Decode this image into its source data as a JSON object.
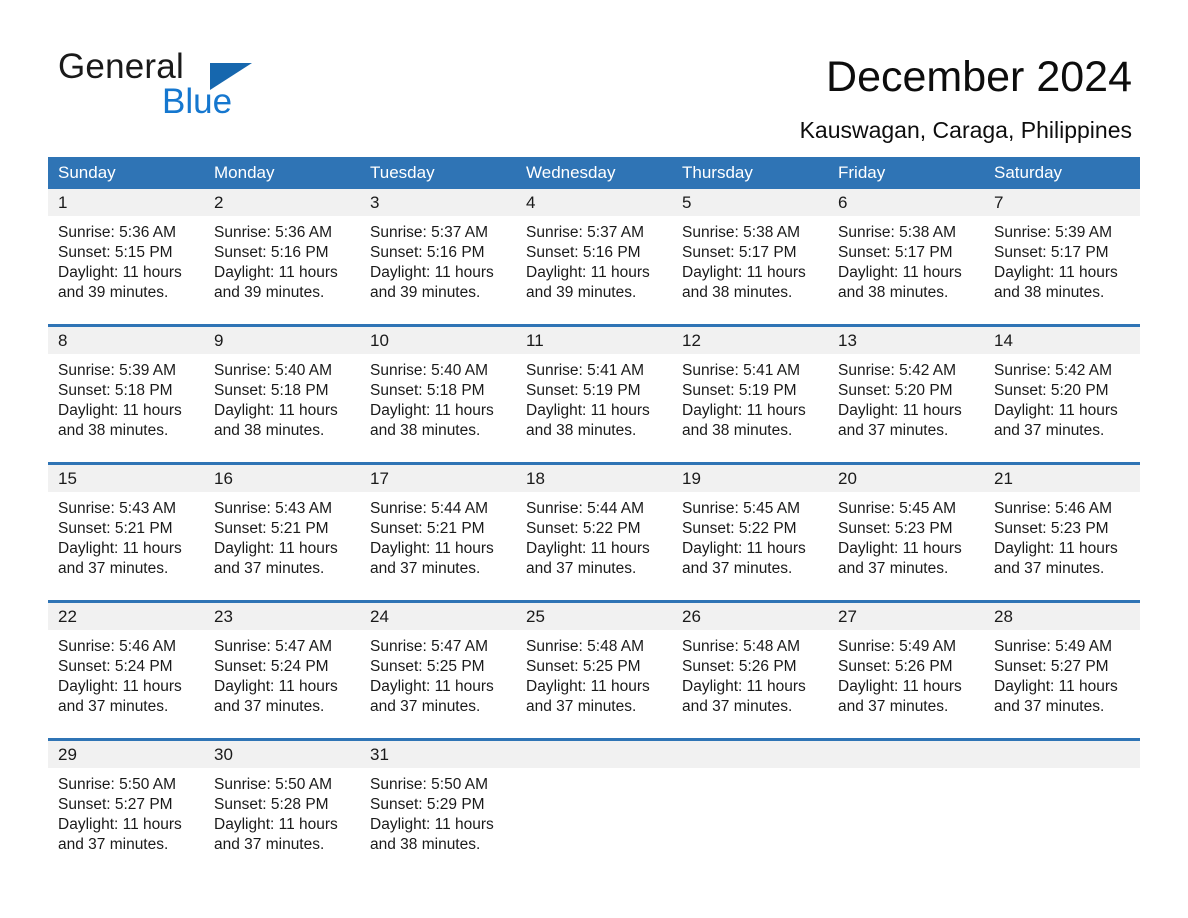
{
  "brand": {
    "name_part1": "General",
    "name_part2": "Blue",
    "triangle_icon": "triangle-icon",
    "accent_color": "#1667ae",
    "blue_text_color": "#1577cf"
  },
  "header": {
    "title": "December 2024",
    "subtitle": "Kauswagan, Caraga, Philippines"
  },
  "calendar": {
    "header_bg": "#2f74b5",
    "day_band_bg": "#f1f1f1",
    "weekdays": [
      "Sunday",
      "Monday",
      "Tuesday",
      "Wednesday",
      "Thursday",
      "Friday",
      "Saturday"
    ],
    "weeks": [
      [
        {
          "day": "1",
          "sunrise": "Sunrise: 5:36 AM",
          "sunset": "Sunset: 5:15 PM",
          "daylight_line1": "Daylight: 11 hours",
          "daylight_line2": "and 39 minutes."
        },
        {
          "day": "2",
          "sunrise": "Sunrise: 5:36 AM",
          "sunset": "Sunset: 5:16 PM",
          "daylight_line1": "Daylight: 11 hours",
          "daylight_line2": "and 39 minutes."
        },
        {
          "day": "3",
          "sunrise": "Sunrise: 5:37 AM",
          "sunset": "Sunset: 5:16 PM",
          "daylight_line1": "Daylight: 11 hours",
          "daylight_line2": "and 39 minutes."
        },
        {
          "day": "4",
          "sunrise": "Sunrise: 5:37 AM",
          "sunset": "Sunset: 5:16 PM",
          "daylight_line1": "Daylight: 11 hours",
          "daylight_line2": "and 39 minutes."
        },
        {
          "day": "5",
          "sunrise": "Sunrise: 5:38 AM",
          "sunset": "Sunset: 5:17 PM",
          "daylight_line1": "Daylight: 11 hours",
          "daylight_line2": "and 38 minutes."
        },
        {
          "day": "6",
          "sunrise": "Sunrise: 5:38 AM",
          "sunset": "Sunset: 5:17 PM",
          "daylight_line1": "Daylight: 11 hours",
          "daylight_line2": "and 38 minutes."
        },
        {
          "day": "7",
          "sunrise": "Sunrise: 5:39 AM",
          "sunset": "Sunset: 5:17 PM",
          "daylight_line1": "Daylight: 11 hours",
          "daylight_line2": "and 38 minutes."
        }
      ],
      [
        {
          "day": "8",
          "sunrise": "Sunrise: 5:39 AM",
          "sunset": "Sunset: 5:18 PM",
          "daylight_line1": "Daylight: 11 hours",
          "daylight_line2": "and 38 minutes."
        },
        {
          "day": "9",
          "sunrise": "Sunrise: 5:40 AM",
          "sunset": "Sunset: 5:18 PM",
          "daylight_line1": "Daylight: 11 hours",
          "daylight_line2": "and 38 minutes."
        },
        {
          "day": "10",
          "sunrise": "Sunrise: 5:40 AM",
          "sunset": "Sunset: 5:18 PM",
          "daylight_line1": "Daylight: 11 hours",
          "daylight_line2": "and 38 minutes."
        },
        {
          "day": "11",
          "sunrise": "Sunrise: 5:41 AM",
          "sunset": "Sunset: 5:19 PM",
          "daylight_line1": "Daylight: 11 hours",
          "daylight_line2": "and 38 minutes."
        },
        {
          "day": "12",
          "sunrise": "Sunrise: 5:41 AM",
          "sunset": "Sunset: 5:19 PM",
          "daylight_line1": "Daylight: 11 hours",
          "daylight_line2": "and 38 minutes."
        },
        {
          "day": "13",
          "sunrise": "Sunrise: 5:42 AM",
          "sunset": "Sunset: 5:20 PM",
          "daylight_line1": "Daylight: 11 hours",
          "daylight_line2": "and 37 minutes."
        },
        {
          "day": "14",
          "sunrise": "Sunrise: 5:42 AM",
          "sunset": "Sunset: 5:20 PM",
          "daylight_line1": "Daylight: 11 hours",
          "daylight_line2": "and 37 minutes."
        }
      ],
      [
        {
          "day": "15",
          "sunrise": "Sunrise: 5:43 AM",
          "sunset": "Sunset: 5:21 PM",
          "daylight_line1": "Daylight: 11 hours",
          "daylight_line2": "and 37 minutes."
        },
        {
          "day": "16",
          "sunrise": "Sunrise: 5:43 AM",
          "sunset": "Sunset: 5:21 PM",
          "daylight_line1": "Daylight: 11 hours",
          "daylight_line2": "and 37 minutes."
        },
        {
          "day": "17",
          "sunrise": "Sunrise: 5:44 AM",
          "sunset": "Sunset: 5:21 PM",
          "daylight_line1": "Daylight: 11 hours",
          "daylight_line2": "and 37 minutes."
        },
        {
          "day": "18",
          "sunrise": "Sunrise: 5:44 AM",
          "sunset": "Sunset: 5:22 PM",
          "daylight_line1": "Daylight: 11 hours",
          "daylight_line2": "and 37 minutes."
        },
        {
          "day": "19",
          "sunrise": "Sunrise: 5:45 AM",
          "sunset": "Sunset: 5:22 PM",
          "daylight_line1": "Daylight: 11 hours",
          "daylight_line2": "and 37 minutes."
        },
        {
          "day": "20",
          "sunrise": "Sunrise: 5:45 AM",
          "sunset": "Sunset: 5:23 PM",
          "daylight_line1": "Daylight: 11 hours",
          "daylight_line2": "and 37 minutes."
        },
        {
          "day": "21",
          "sunrise": "Sunrise: 5:46 AM",
          "sunset": "Sunset: 5:23 PM",
          "daylight_line1": "Daylight: 11 hours",
          "daylight_line2": "and 37 minutes."
        }
      ],
      [
        {
          "day": "22",
          "sunrise": "Sunrise: 5:46 AM",
          "sunset": "Sunset: 5:24 PM",
          "daylight_line1": "Daylight: 11 hours",
          "daylight_line2": "and 37 minutes."
        },
        {
          "day": "23",
          "sunrise": "Sunrise: 5:47 AM",
          "sunset": "Sunset: 5:24 PM",
          "daylight_line1": "Daylight: 11 hours",
          "daylight_line2": "and 37 minutes."
        },
        {
          "day": "24",
          "sunrise": "Sunrise: 5:47 AM",
          "sunset": "Sunset: 5:25 PM",
          "daylight_line1": "Daylight: 11 hours",
          "daylight_line2": "and 37 minutes."
        },
        {
          "day": "25",
          "sunrise": "Sunrise: 5:48 AM",
          "sunset": "Sunset: 5:25 PM",
          "daylight_line1": "Daylight: 11 hours",
          "daylight_line2": "and 37 minutes."
        },
        {
          "day": "26",
          "sunrise": "Sunrise: 5:48 AM",
          "sunset": "Sunset: 5:26 PM",
          "daylight_line1": "Daylight: 11 hours",
          "daylight_line2": "and 37 minutes."
        },
        {
          "day": "27",
          "sunrise": "Sunrise: 5:49 AM",
          "sunset": "Sunset: 5:26 PM",
          "daylight_line1": "Daylight: 11 hours",
          "daylight_line2": "and 37 minutes."
        },
        {
          "day": "28",
          "sunrise": "Sunrise: 5:49 AM",
          "sunset": "Sunset: 5:27 PM",
          "daylight_line1": "Daylight: 11 hours",
          "daylight_line2": "and 37 minutes."
        }
      ],
      [
        {
          "day": "29",
          "sunrise": "Sunrise: 5:50 AM",
          "sunset": "Sunset: 5:27 PM",
          "daylight_line1": "Daylight: 11 hours",
          "daylight_line2": "and 37 minutes."
        },
        {
          "day": "30",
          "sunrise": "Sunrise: 5:50 AM",
          "sunset": "Sunset: 5:28 PM",
          "daylight_line1": "Daylight: 11 hours",
          "daylight_line2": "and 37 minutes."
        },
        {
          "day": "31",
          "sunrise": "Sunrise: 5:50 AM",
          "sunset": "Sunset: 5:29 PM",
          "daylight_line1": "Daylight: 11 hours",
          "daylight_line2": "and 38 minutes."
        },
        {
          "day": "",
          "sunrise": "",
          "sunset": "",
          "daylight_line1": "",
          "daylight_line2": ""
        },
        {
          "day": "",
          "sunrise": "",
          "sunset": "",
          "daylight_line1": "",
          "daylight_line2": ""
        },
        {
          "day": "",
          "sunrise": "",
          "sunset": "",
          "daylight_line1": "",
          "daylight_line2": ""
        },
        {
          "day": "",
          "sunrise": "",
          "sunset": "",
          "daylight_line1": "",
          "daylight_line2": ""
        }
      ]
    ]
  }
}
